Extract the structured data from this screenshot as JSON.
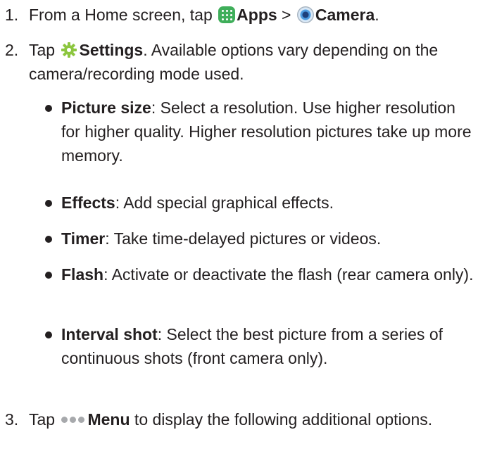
{
  "steps": [
    {
      "number": "1.",
      "pre": "From a Home screen, tap",
      "apps_label": "Apps",
      "sep": ">",
      "camera_label": "Camera",
      "end": "."
    },
    {
      "number": "2.",
      "pre": "Tap",
      "settings_label": "Settings",
      "rest": ". Available options vary depending on the camera/recording mode used."
    },
    {
      "number": "3.",
      "pre": "Tap",
      "menu_label": "Menu",
      "rest": " to display the following additional options."
    }
  ],
  "options": [
    {
      "term": "Picture size",
      "desc": ": Select a resolution. Use higher resolution for higher quality. Higher resolution pictures take up more memory."
    },
    {
      "term": "Effects",
      "desc": ": Add special graphical effects."
    },
    {
      "term": "Timer",
      "desc": ": Take time-delayed pictures or videos."
    },
    {
      "term": "Flash",
      "desc": ": Activate or deactivate the flash (rear camera only)."
    },
    {
      "term": "Interval shot",
      "desc": ": Select the best picture from a series of continuous shots (front camera only)."
    }
  ],
  "icons": {
    "apps": "apps-icon",
    "camera": "camera-icon",
    "settings": "gear-icon",
    "menu": "more-dots-icon"
  },
  "colors": {
    "text": "#231f20",
    "apps_icon": "#3fae5a",
    "gear_icon": "#8cc63f",
    "menu_dots": "#a7a9ac"
  }
}
